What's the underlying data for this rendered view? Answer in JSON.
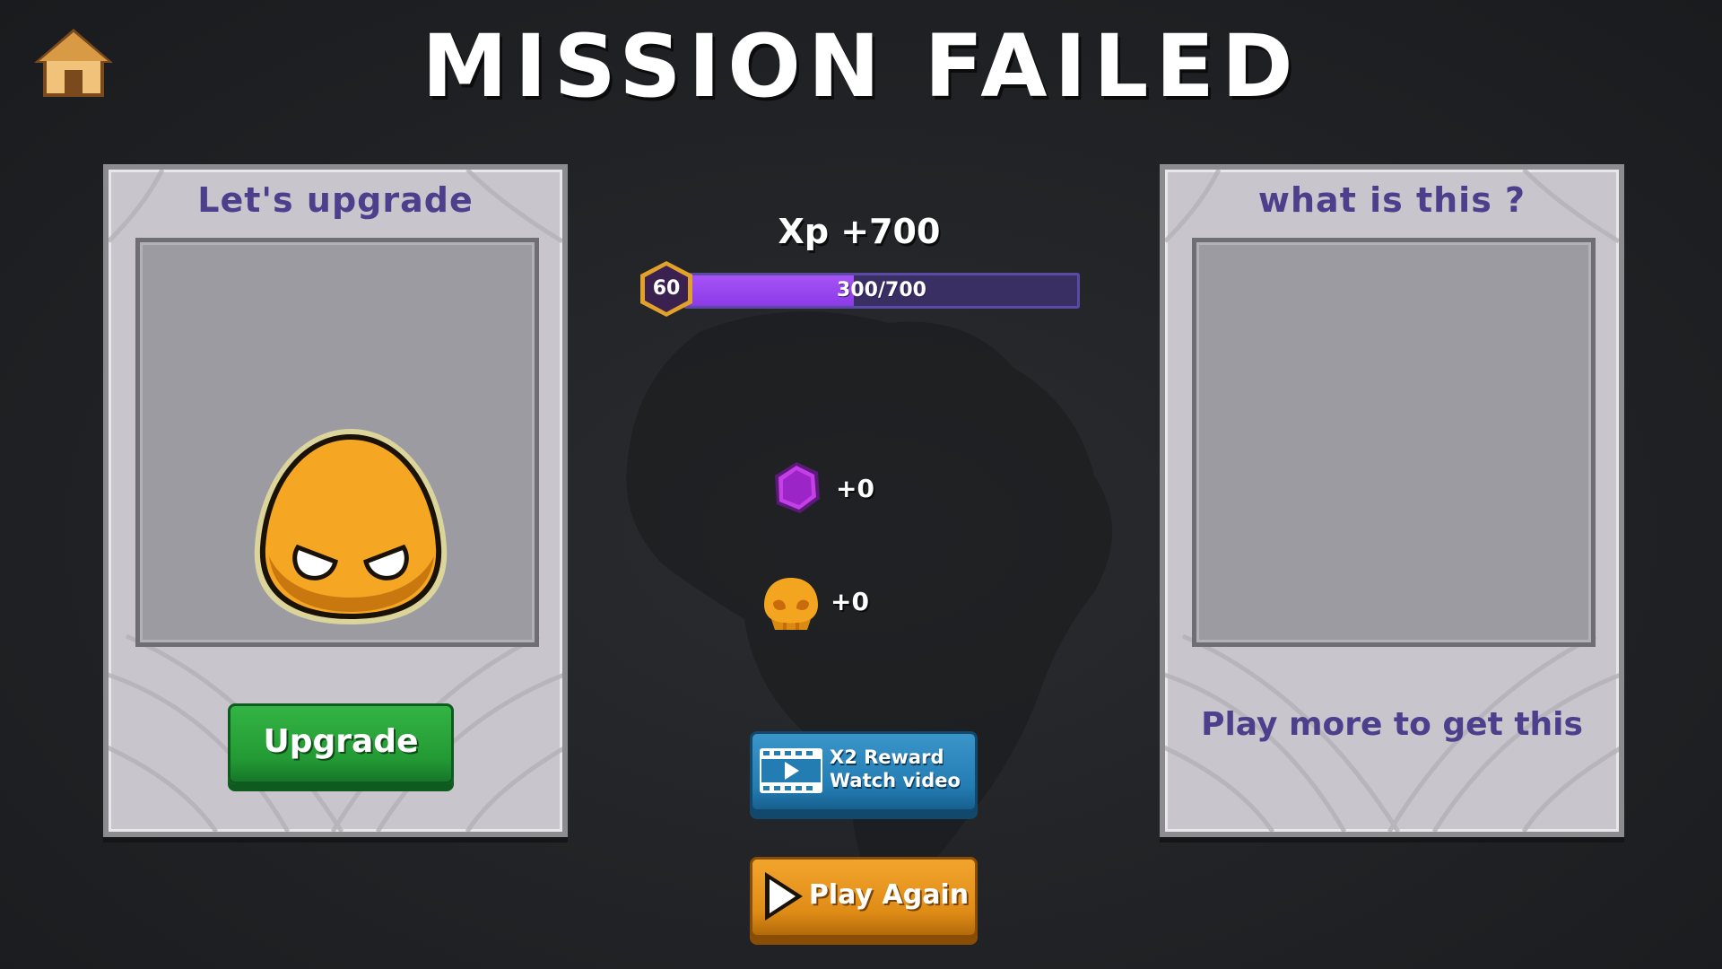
{
  "title": "MISSION FAILED",
  "home": {
    "icon": "home-icon"
  },
  "upgrade_card": {
    "title": "Let's upgrade",
    "character_icon": "orange-blob-character",
    "button_label": "Upgrade"
  },
  "mystery_card": {
    "title": "what is this ?",
    "hint": "Play more to get this"
  },
  "xp": {
    "label": "Xp +700",
    "level": "60",
    "progress_text": "300/700",
    "progress": 0.4286
  },
  "rewards": [
    {
      "icon": "purple-gem-icon",
      "value": "+0"
    },
    {
      "icon": "skull-coin-icon",
      "value": "+0"
    }
  ],
  "video_button": {
    "line1": "X2 Reward",
    "line2": "Watch video",
    "icon": "video-icon"
  },
  "play_again": {
    "label": "Play Again",
    "icon": "play-icon"
  },
  "colors": {
    "background": "#1f2124",
    "card": "#c8c6cc",
    "card_title": "#4c3f8c",
    "xp_fill": "#9b47ef",
    "upgrade_button": "#239a34",
    "video_button": "#237db3",
    "play_button": "#df8c17"
  }
}
